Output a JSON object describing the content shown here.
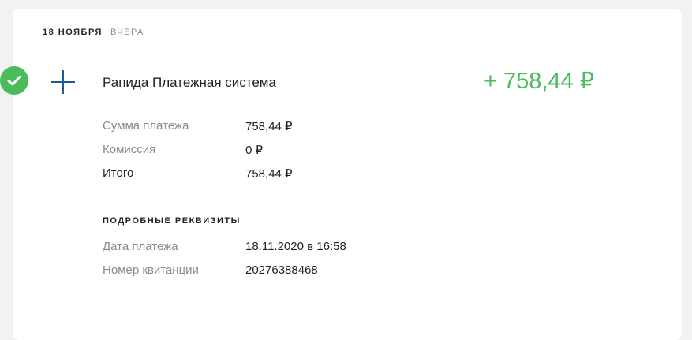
{
  "header": {
    "date": "18 НОЯБРЯ",
    "relative": "ВЧЕРА"
  },
  "operation": {
    "status_icon": "checkmark-icon",
    "type_icon": "plus-icon",
    "title": "Рапида Платежная система",
    "amount": "+ 758,44 ₽",
    "colors": {
      "success": "#4cbb5c",
      "icon": "#1e5a96"
    }
  },
  "details": [
    {
      "label": "Сумма платежа",
      "value": "758,44 ₽"
    },
    {
      "label": "Комиссия",
      "value": "0 ₽"
    },
    {
      "label": "Итого",
      "value": "758,44 ₽"
    }
  ],
  "requisites": {
    "title": "ПОДРОБНЫЕ РЕКВИЗИТЫ",
    "rows": [
      {
        "label": "Дата платежа",
        "value": "18.11.2020 в 16:58"
      },
      {
        "label": "Номер квитанции",
        "value": "20276388468"
      }
    ]
  }
}
